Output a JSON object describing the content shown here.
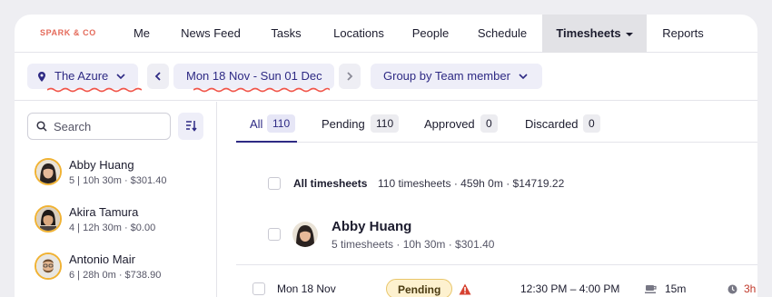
{
  "brand": {
    "logo": "SPARK & CO",
    "accent": "#e46a5a",
    "primary": "#2e2a84"
  },
  "nav": {
    "items": [
      {
        "label": "Me"
      },
      {
        "label": "News Feed"
      },
      {
        "label": "Tasks"
      },
      {
        "label": "Locations"
      },
      {
        "label": "People"
      },
      {
        "label": "Schedule"
      },
      {
        "label": "Timesheets",
        "active": true,
        "dropdown": true
      },
      {
        "label": "Reports"
      }
    ]
  },
  "filters": {
    "location": "The Azure",
    "date_range": "Mon 18 Nov - Sun 01 Dec",
    "group_by": "Group by Team member"
  },
  "sidebar": {
    "search_placeholder": "Search",
    "people": [
      {
        "name": "Abby Huang",
        "meta": "5 | 10h 30m · $301.40"
      },
      {
        "name": "Akira Tamura",
        "meta": "4 | 12h 30m · $0.00"
      },
      {
        "name": "Antonio Mair",
        "meta": "6 | 28h 0m · $738.90"
      }
    ]
  },
  "tabs": [
    {
      "label": "All",
      "count": "110",
      "active": true
    },
    {
      "label": "Pending",
      "count": "110"
    },
    {
      "label": "Approved",
      "count": "0"
    },
    {
      "label": "Discarded",
      "count": "0"
    }
  ],
  "summary": {
    "title": "All timesheets",
    "meta": "110 timesheets · 459h 0m · $14719.22"
  },
  "employee": {
    "name": "Abby Huang",
    "meta": "5 timesheets · 10h 30m · $301.40"
  },
  "timesheet_row": {
    "date": "Mon 18 Nov",
    "status": "Pending",
    "time": "12:30 PM – 4:00 PM",
    "break": "15m",
    "duration": "3h"
  }
}
